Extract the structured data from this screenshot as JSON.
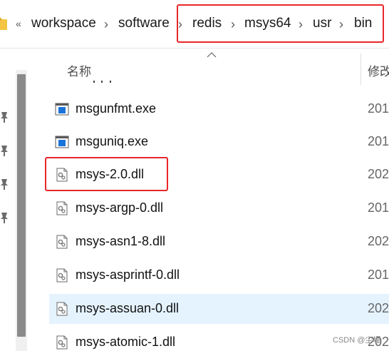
{
  "breadcrumb": {
    "overflow_glyph": "«",
    "items": [
      "workspace",
      "software",
      "redis",
      "msys64",
      "usr",
      "bin"
    ],
    "separator": "›"
  },
  "header": {
    "name_label": "名称",
    "date_label": "修改"
  },
  "files": [
    {
      "name": "msgunfmt.exe",
      "date": "201",
      "icon": "exe-icon",
      "selected": false
    },
    {
      "name": "msguniq.exe",
      "date": "201",
      "icon": "exe-icon",
      "selected": false
    },
    {
      "name": "msys-2.0.dll",
      "date": "202",
      "icon": "dll-icon",
      "selected": false
    },
    {
      "name": "msys-argp-0.dll",
      "date": "201",
      "icon": "dll-icon",
      "selected": false
    },
    {
      "name": "msys-asn1-8.dll",
      "date": "202",
      "icon": "dll-icon",
      "selected": false
    },
    {
      "name": "msys-asprintf-0.dll",
      "date": "201",
      "icon": "dll-icon",
      "selected": false
    },
    {
      "name": "msys-assuan-0.dll",
      "date": "202",
      "icon": "dll-icon",
      "selected": true
    },
    {
      "name": "msys-atomic-1.dll",
      "date": "202",
      "icon": "dll-icon",
      "selected": false
    }
  ],
  "watermark": "CSDN @尘埋",
  "colors": {
    "highlight_red": "#e8272a",
    "selected_row": "#e5f3ff",
    "folder_yellow": "#f4c542"
  }
}
